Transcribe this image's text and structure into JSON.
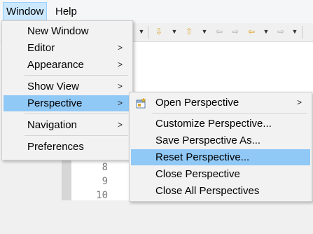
{
  "menubar": {
    "window_label": "Window",
    "help_label": "Help"
  },
  "editor": {
    "line_numbers": [
      "8",
      "9",
      "10"
    ]
  },
  "window_menu": {
    "items": [
      {
        "label": "New Window",
        "submenu": false
      },
      {
        "label": "Editor",
        "submenu": true
      },
      {
        "label": "Appearance",
        "submenu": true
      },
      {
        "label": "Show View",
        "submenu": true
      },
      {
        "label": "Perspective",
        "submenu": true,
        "highlighted": true
      },
      {
        "label": "Navigation",
        "submenu": true
      },
      {
        "label": "Preferences",
        "submenu": false
      }
    ]
  },
  "perspective_menu": {
    "items": [
      {
        "label": "Open Perspective",
        "submenu": true,
        "icon": "open-perspective-icon"
      },
      {
        "label": "Customize Perspective...",
        "submenu": false
      },
      {
        "label": "Save Perspective As...",
        "submenu": false
      },
      {
        "label": "Reset Perspective...",
        "submenu": false,
        "highlighted": true
      },
      {
        "label": "Close Perspective",
        "submenu": false
      },
      {
        "label": "Close All Perspectives",
        "submenu": false
      }
    ]
  },
  "submenu_arrow": ">",
  "colors": {
    "highlight": "#90c8f6",
    "menubar_active": "#cce8ff"
  }
}
